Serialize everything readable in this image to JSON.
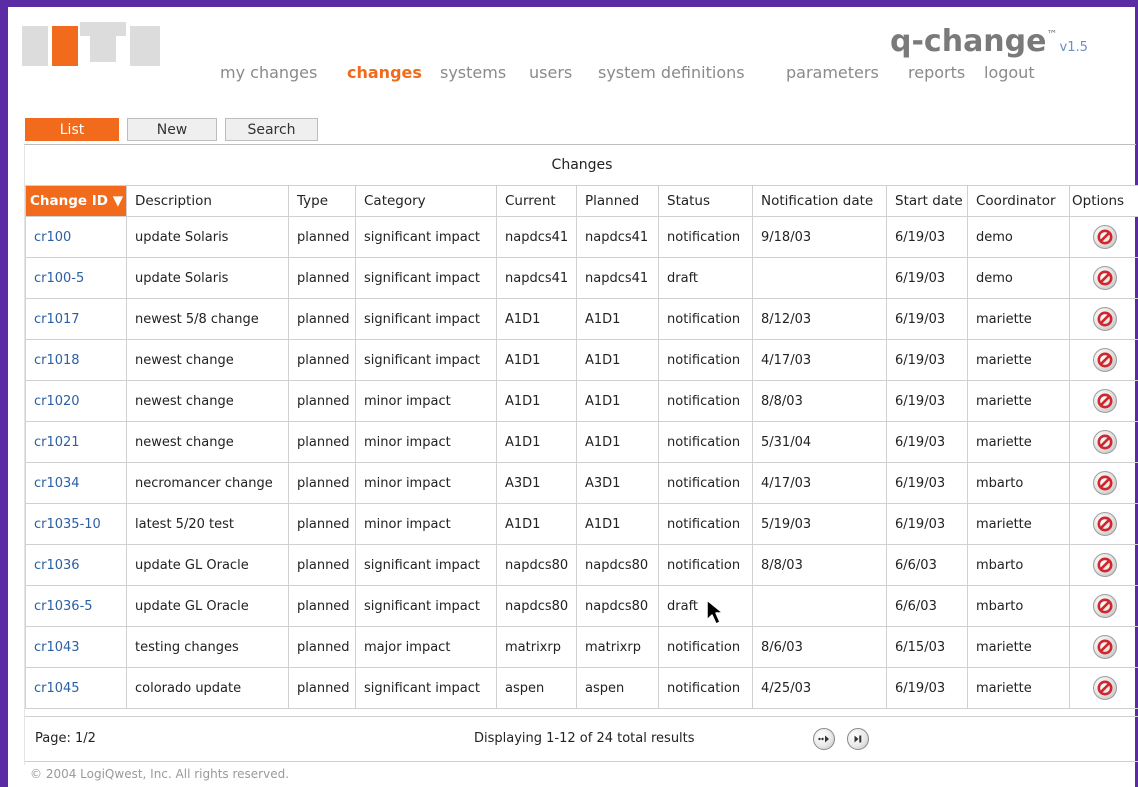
{
  "app": {
    "name": "q-change",
    "tm": "™",
    "version": "v1.5"
  },
  "nav": {
    "items": [
      "my changes",
      "changes",
      "systems",
      "users",
      "system definitions",
      "parameters",
      "reports",
      "logout"
    ],
    "active": "changes"
  },
  "tabs": [
    "List",
    "New",
    "Search"
  ],
  "table": {
    "caption": "Changes",
    "columns": [
      "Change ID",
      "Description",
      "Type",
      "Category",
      "Current",
      "Planned",
      "Status",
      "Notification date",
      "Start date",
      "Coordinator",
      "Options"
    ],
    "sort_indicator": "▼",
    "rows": [
      [
        "cr100",
        "update Solaris",
        "planned",
        "significant impact",
        "napdcs41",
        "napdcs41",
        "notification",
        "9/18/03",
        "6/19/03",
        "demo"
      ],
      [
        "cr100-5",
        "update Solaris",
        "planned",
        "significant impact",
        "napdcs41",
        "napdcs41",
        "draft",
        "",
        "6/19/03",
        "demo"
      ],
      [
        "cr1017",
        "newest 5/8 change",
        "planned",
        "significant impact",
        "A1D1",
        "A1D1",
        "notification",
        "8/12/03",
        "6/19/03",
        "mariette"
      ],
      [
        "cr1018",
        "newest change",
        "planned",
        "significant impact",
        "A1D1",
        "A1D1",
        "notification",
        "4/17/03",
        "6/19/03",
        "mariette"
      ],
      [
        "cr1020",
        "newest change",
        "planned",
        "minor impact",
        "A1D1",
        "A1D1",
        "notification",
        "8/8/03",
        "6/19/03",
        "mariette"
      ],
      [
        "cr1021",
        "newest change",
        "planned",
        "minor impact",
        "A1D1",
        "A1D1",
        "notification",
        "5/31/04",
        "6/19/03",
        "mariette"
      ],
      [
        "cr1034",
        "necromancer change",
        "planned",
        "minor impact",
        "A3D1",
        "A3D1",
        "notification",
        "4/17/03",
        "6/19/03",
        "mbarto"
      ],
      [
        "cr1035-10",
        "latest 5/20 test",
        "planned",
        "minor impact",
        "A1D1",
        "A1D1",
        "notification",
        "5/19/03",
        "6/19/03",
        "mariette"
      ],
      [
        "cr1036",
        "update GL Oracle",
        "planned",
        "significant impact",
        "napdcs80",
        "napdcs80",
        "notification",
        "8/8/03",
        "6/6/03",
        "mbarto"
      ],
      [
        "cr1036-5",
        "update GL Oracle",
        "planned",
        "significant impact",
        "napdcs80",
        "napdcs80",
        "draft",
        "",
        "6/6/03",
        "mbarto"
      ],
      [
        "cr1043",
        "testing changes",
        "planned",
        "major impact",
        "matrixrp",
        "matrixrp",
        "notification",
        "8/6/03",
        "6/15/03",
        "mariette"
      ],
      [
        "cr1045",
        "colorado update",
        "planned",
        "significant impact",
        "aspen",
        "aspen",
        "notification",
        "4/25/03",
        "6/19/03",
        "mariette"
      ]
    ],
    "row_icon": "delete-icon"
  },
  "pagination": {
    "page": "Page: 1/2",
    "summary": "Displaying 1-12 of 24 total results",
    "next_icon": "next-page-icon",
    "last_icon": "last-page-icon"
  },
  "footer": {
    "copyright": "© 2004  LogiQwest, Inc. All rights reserved."
  },
  "colors": {
    "accent": "#f26b1c",
    "frame": "#5b2ba6",
    "link": "#2b5fa5",
    "delete": "#d0262c"
  }
}
